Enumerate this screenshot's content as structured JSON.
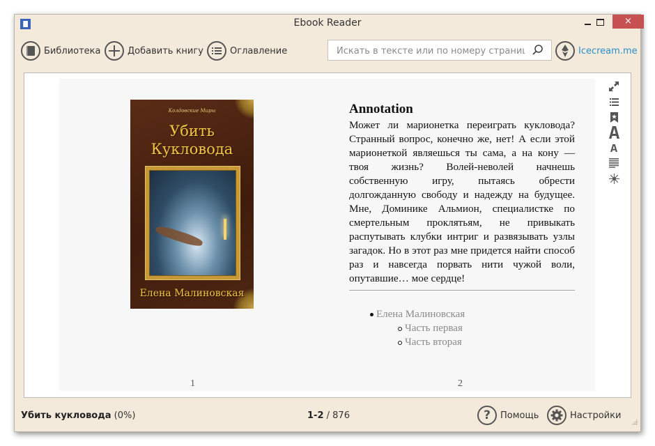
{
  "window": {
    "title": "Ebook Reader",
    "controls": {
      "minimize": "minimize",
      "maximize": "maximize",
      "close": "×"
    }
  },
  "toolbar": {
    "library_label": "Библиотека",
    "add_book_label": "Добавить книгу",
    "toc_label": "Оглавление",
    "search_placeholder": "Искать в тексте или по номеру страницы",
    "search_value": "",
    "brand_label": "Icecream.me",
    "brand_color": "#2a8fc9"
  },
  "book": {
    "cover": {
      "series": "Колдовские Миры",
      "title_line1": "Убить",
      "title_line2": "Кукловода",
      "author": "Елена Малиновская"
    },
    "annotation": {
      "heading": "Annotation",
      "text": "Может ли марионетка переиграть кукловода? Странный вопрос, конечно же, нет! А если этой марионеткой являешься ты сама, а на кону — твоя жизнь? Волей-неволей начнешь собственную игру, пытаясь обрести долгожданную свободу и надежду на будущее. Мне, Доминике Альмион, специалистке по смертельным проклятьям, не привыкать распутывать клубки интриг и развязывать узлы загадок. Но в этот раз мне придется найти способ раз и навсегда порвать нити чужой воли, опутавшие… мое сердце!"
    },
    "toc": {
      "author": "Елена Малиновская",
      "parts": [
        "Часть первая",
        "Часть вторая"
      ]
    },
    "page_numbers": {
      "left": "1",
      "right": "2"
    }
  },
  "side_tools": [
    {
      "icon": "fullscreen-icon"
    },
    {
      "icon": "contents-icon"
    },
    {
      "icon": "bookmark-icon"
    },
    {
      "icon": "font-increase-icon"
    },
    {
      "icon": "font-decrease-icon"
    },
    {
      "icon": "text-align-icon"
    },
    {
      "icon": "brightness-icon"
    }
  ],
  "status": {
    "book_title": "Убить кукловода",
    "progress": "(0%)",
    "current_pages": "1-2",
    "total_pages": "/ 876",
    "help_label": "Помощь",
    "settings_label": "Настройки"
  }
}
